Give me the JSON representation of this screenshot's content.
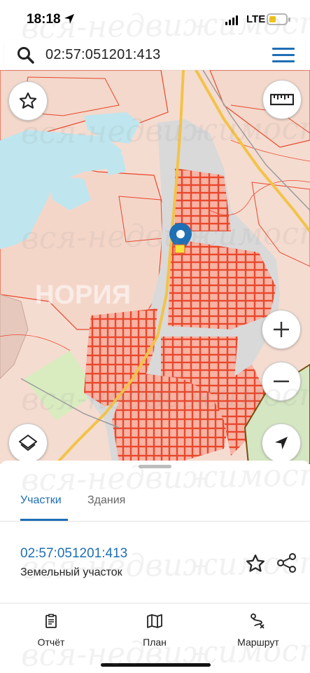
{
  "status": {
    "time": "18:18",
    "network": "LTE"
  },
  "search": {
    "query": "02:57:051201:413"
  },
  "map": {
    "watermark_center": "НОРИЯ"
  },
  "watermark": "вся-недвижимость.net",
  "tabs": {
    "parcels": "Участки",
    "buildings": "Здания"
  },
  "parcel": {
    "id": "02:57:051201:413",
    "type": "Земельный участок"
  },
  "bottom_nav": [
    {
      "label": "Отчёт",
      "icon": "report-icon"
    },
    {
      "label": "План",
      "icon": "map-plan-icon"
    },
    {
      "label": "Маршрут",
      "icon": "route-icon"
    }
  ],
  "colors": {
    "accent": "#1e6fb4",
    "parcel_fill": "#f7b3a4",
    "parcel_stroke": "#e8482c",
    "water": "#bfe6ee",
    "road": "#f2c34a"
  }
}
